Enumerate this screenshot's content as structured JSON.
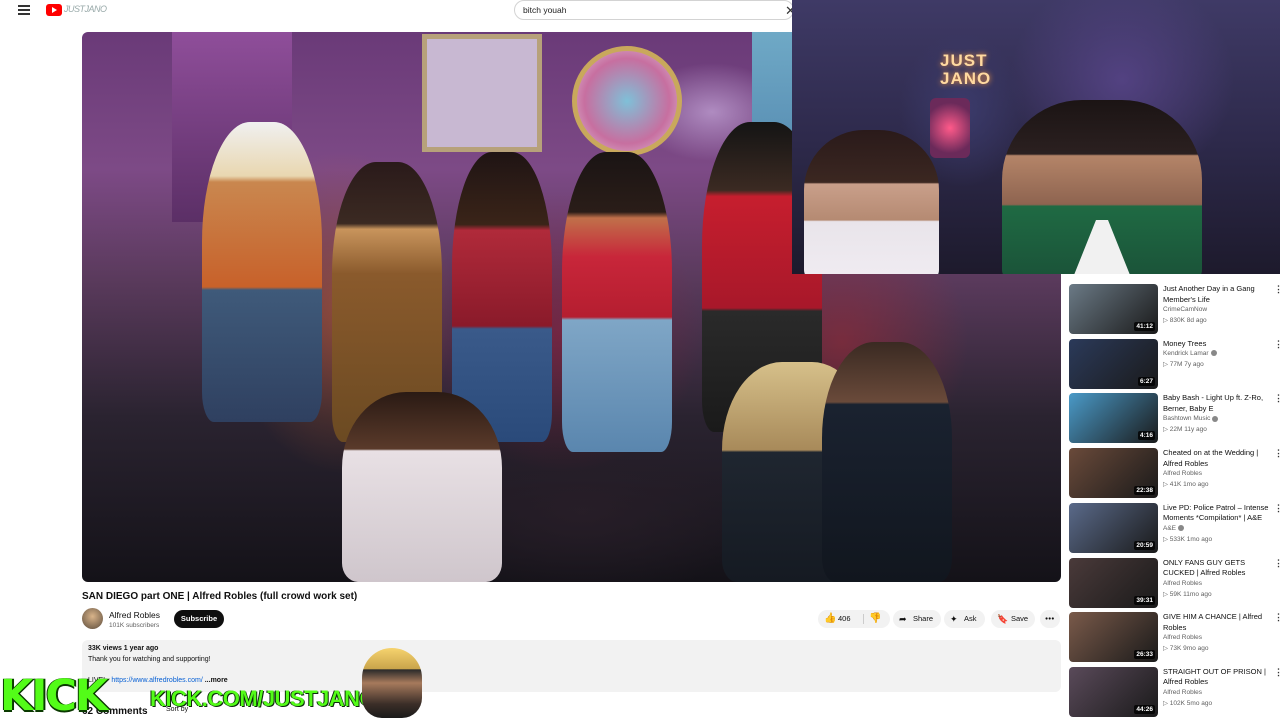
{
  "header": {
    "search_query": "bitch youah",
    "clear_glyph": "✕",
    "logo_text": "JUSTJANO"
  },
  "video": {
    "title": "SAN DIEGO part ONE | Alfred Robles (full crowd work set)",
    "channel": "Alfred Robles",
    "subscribers": "101K subscribers",
    "subscribe_label": "Subscribe",
    "likes": "406",
    "share_label": "Share",
    "ask_label": "Ask",
    "save_label": "Save",
    "more_glyph": "•••"
  },
  "description": {
    "meta": "33K views  1 year ago",
    "line1": "Thank you for watching and supporting!",
    "link_prefix": "LIVE! · ",
    "link": "https://www.alfredrobles.com/",
    "more": "...more"
  },
  "comments": {
    "heading": "62 Comments",
    "sort_label": "Sort by"
  },
  "recommendations": [
    {
      "title": "Just Another Day in a Gang Member's Life",
      "channel": "CrimeCamNow",
      "stats": "▷ 830K  8d ago",
      "duration": "41:12",
      "color": "#6b7a86"
    },
    {
      "title": "Money Trees",
      "channel": "Kendrick Lamar",
      "stats": "▷ 77M  7y ago",
      "duration": "6:27",
      "color": "#2b3a5a",
      "verified": true
    },
    {
      "title": "Baby Bash - Light Up ft. Z-Ro, Berner, Baby E",
      "channel": "Bashtown Music",
      "stats": "▷ 22M  11y ago",
      "duration": "4:16",
      "color": "#4a9ac8",
      "verified": true
    },
    {
      "title": "Cheated on at the Wedding | Alfred Robles",
      "channel": "Alfred Robles",
      "stats": "▷ 41K  1mo ago",
      "duration": "22:38",
      "color": "#6a4a3a"
    },
    {
      "title": "Live PD: Police Patrol – Intense Moments *Compilation* | A&E",
      "channel": "A&E",
      "stats": "▷ 533K  1mo ago",
      "duration": "20:59",
      "color": "#5a6a8a",
      "verified": true
    },
    {
      "title": "ONLY FANS GUY GETS CUCKED | Alfred Robles",
      "channel": "Alfred Robles",
      "stats": "▷ 59K  11mo ago",
      "duration": "39:31",
      "color": "#4a3a3a"
    },
    {
      "title": "GIVE HIM A CHANCE | Alfred Robles",
      "channel": "Alfred Robles",
      "stats": "▷ 73K  9mo ago",
      "duration": "26:33",
      "color": "#7a5a4a"
    },
    {
      "title": "STRAIGHT OUT OF PRISON | Alfred Robles",
      "channel": "Alfred Robles",
      "stats": "▷ 102K  5mo ago",
      "duration": "44:26",
      "color": "#5a4a5a"
    }
  ],
  "overlay": {
    "neon_sign": "JUST\nJANO",
    "kick_logo": "KICK",
    "kick_url": "KICK.COM/JUSTJANOTV"
  },
  "colors": {
    "accent": "#ff0000",
    "kick_green": "#53fc18",
    "link": "#065fd4"
  }
}
